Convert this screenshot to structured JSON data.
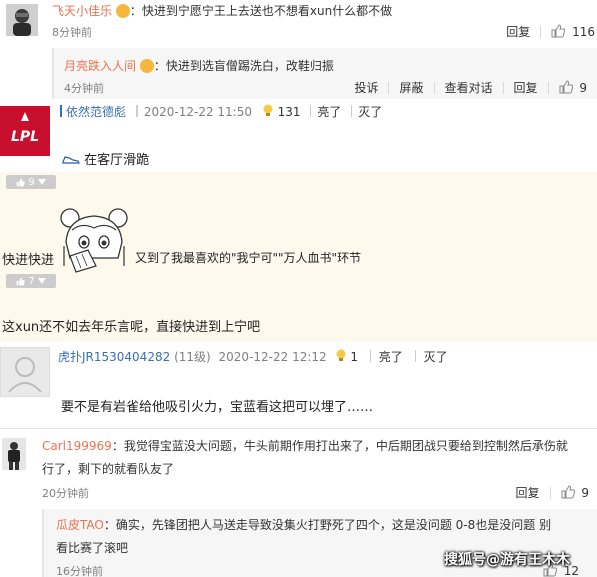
{
  "comments": {
    "c1": {
      "username": "飞天小佳乐",
      "colon": "：",
      "text": "快进到宁愿宁王上去送也不想看xun什么都不做",
      "time": "8分钟前",
      "reply_label": "回复",
      "like_count": "116"
    },
    "c1_reply": {
      "username": "月亮跌入人间",
      "colon": "：",
      "text": "快进到选盲僧踢洗白，改鞋归振",
      "time": "4分钟前",
      "report": "投诉",
      "block": "屏蔽",
      "view_dialog": "查看对话",
      "reply_label": "回复",
      "like_count": "9"
    },
    "c2": {
      "username": "依然范德彪",
      "date": "2020-12-22 11:50",
      "bulb_count": "131",
      "light": "亮了",
      "dim": "灭了",
      "text": "在客厅滑跪",
      "badge_count": "9"
    },
    "c3": {
      "text_before": "快进快进",
      "text_after": "又到了我最喜欢的\"我宁可\"\"万人血书\"环节",
      "badge_count": "7"
    },
    "c4": {
      "text": "这xun还不如去年乐言呢，直接快进到上宁吧"
    },
    "c5": {
      "username": "虎扑JR1530404282",
      "level": "(11级)",
      "date": "2020-12-22 12:12",
      "bulb_count": "1",
      "light": "亮了",
      "dim": "灭了",
      "text": "要不是有岩雀给他吸引火力，宝蓝看这把可以埋了……"
    },
    "c6": {
      "username": "Carl199969",
      "colon": "：",
      "text_line1": "我觉得宝蓝没大问题，牛头前期作用打出来了，中后期团战只要给到控制然后承伤就",
      "text_line2": "行了，剩下的就看队友了",
      "time": "20分钟前",
      "reply_label": "回复",
      "like_count": "9"
    },
    "c6_reply": {
      "username": "瓜皮TAO",
      "colon": "：",
      "text_line1": "确实，先锋团把人马送走导致没集火打野死了四个，这是没问题 0-8也是没问题 别",
      "text_line2": "看比赛了滚吧",
      "time": "16分钟前",
      "like_count": "12"
    }
  },
  "watermark": "搜狐号@游有王木木",
  "lpl_logo_text": "LPL",
  "colors": {
    "username": "#eb7350",
    "blue_name": "#3a6fb0",
    "cream_bg": "#fdf9ec",
    "badge": "#cccccc"
  }
}
